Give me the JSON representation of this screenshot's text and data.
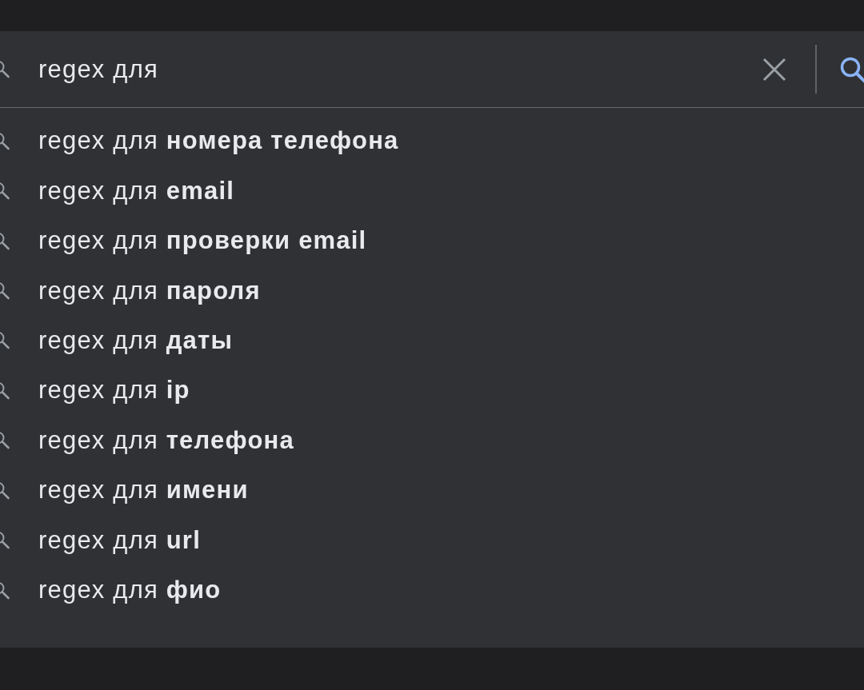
{
  "search_bar": {
    "value": "regex для"
  },
  "suggestions": [
    {
      "text": "regex для **номера телефона**"
    },
    {
      "text": "regex для **email**"
    },
    {
      "text": "regex для **проверки email**"
    },
    {
      "text": "regex для **пароля**"
    },
    {
      "text": "regex для **даты**"
    },
    {
      "text": "regex для **ip**"
    },
    {
      "text": "regex для **телефона**"
    },
    {
      "text": "regex для **имени**"
    },
    {
      "text": "regex для **url**"
    },
    {
      "text": "regex для **фио**"
    }
  ]
}
